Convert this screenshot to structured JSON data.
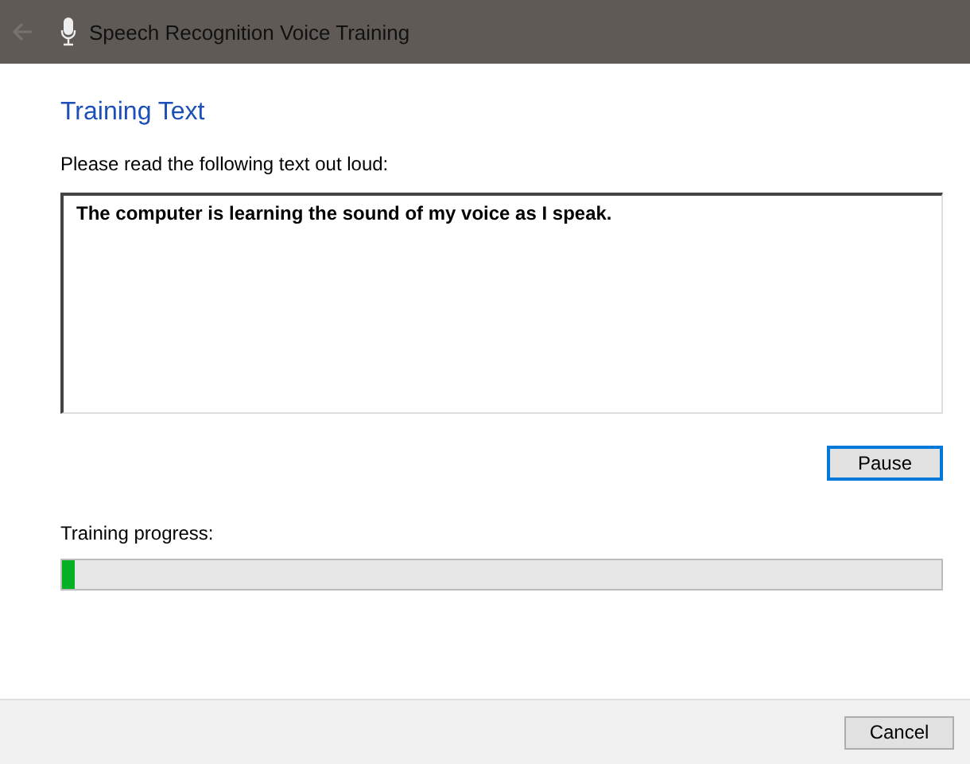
{
  "window": {
    "title": "Speech Recognition Voice Training"
  },
  "heading": "Training Text",
  "instruction": "Please read the following text out loud:",
  "training_text": "The computer is learning the sound of my voice as I speak.",
  "pause_button": {
    "label": "Pause",
    "focused": true
  },
  "progress": {
    "label": "Training progress:",
    "level": 0.015
  },
  "footer": {
    "buttons": [
      "Cancel"
    ]
  }
}
